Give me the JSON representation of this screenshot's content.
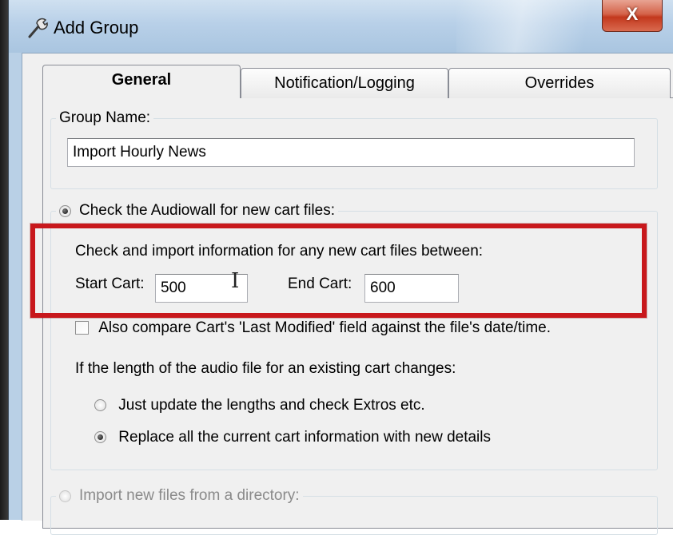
{
  "window": {
    "title": "Add Group",
    "close_glyph": "X"
  },
  "tabs": [
    {
      "label": "General",
      "active": true
    },
    {
      "label": "Notification/Logging",
      "active": false
    },
    {
      "label": "Overrides",
      "active": false
    }
  ],
  "group_name": {
    "legend": "Group Name:",
    "value": "Import Hourly News"
  },
  "audiowall": {
    "legend": "Check the Audiowall for new cart files:",
    "selected": true,
    "instructions": "Check and import information for any new cart files between:",
    "start_cart_label": "Start Cart:",
    "start_cart_value": "500",
    "end_cart_label": "End Cart:",
    "end_cart_value": "600",
    "compare_label": "Also compare Cart's 'Last Modified' field against the file's date/time.",
    "compare_checked": false,
    "length_change_label": "If the length of the audio file for an existing cart changes:",
    "option_update_lengths": "Just update the lengths and check Extros etc.",
    "option_replace": "Replace all the current cart information with new details",
    "selected_option": "replace"
  },
  "directory": {
    "legend": "Import new files from a directory:",
    "selected": false
  },
  "icons": [
    "hammer-icon",
    "close-icon",
    "text-cursor-icon"
  ],
  "colors": {
    "highlight": "#c8181c",
    "close_button": "#c3381d",
    "titlebar": "#b8d0e8"
  }
}
